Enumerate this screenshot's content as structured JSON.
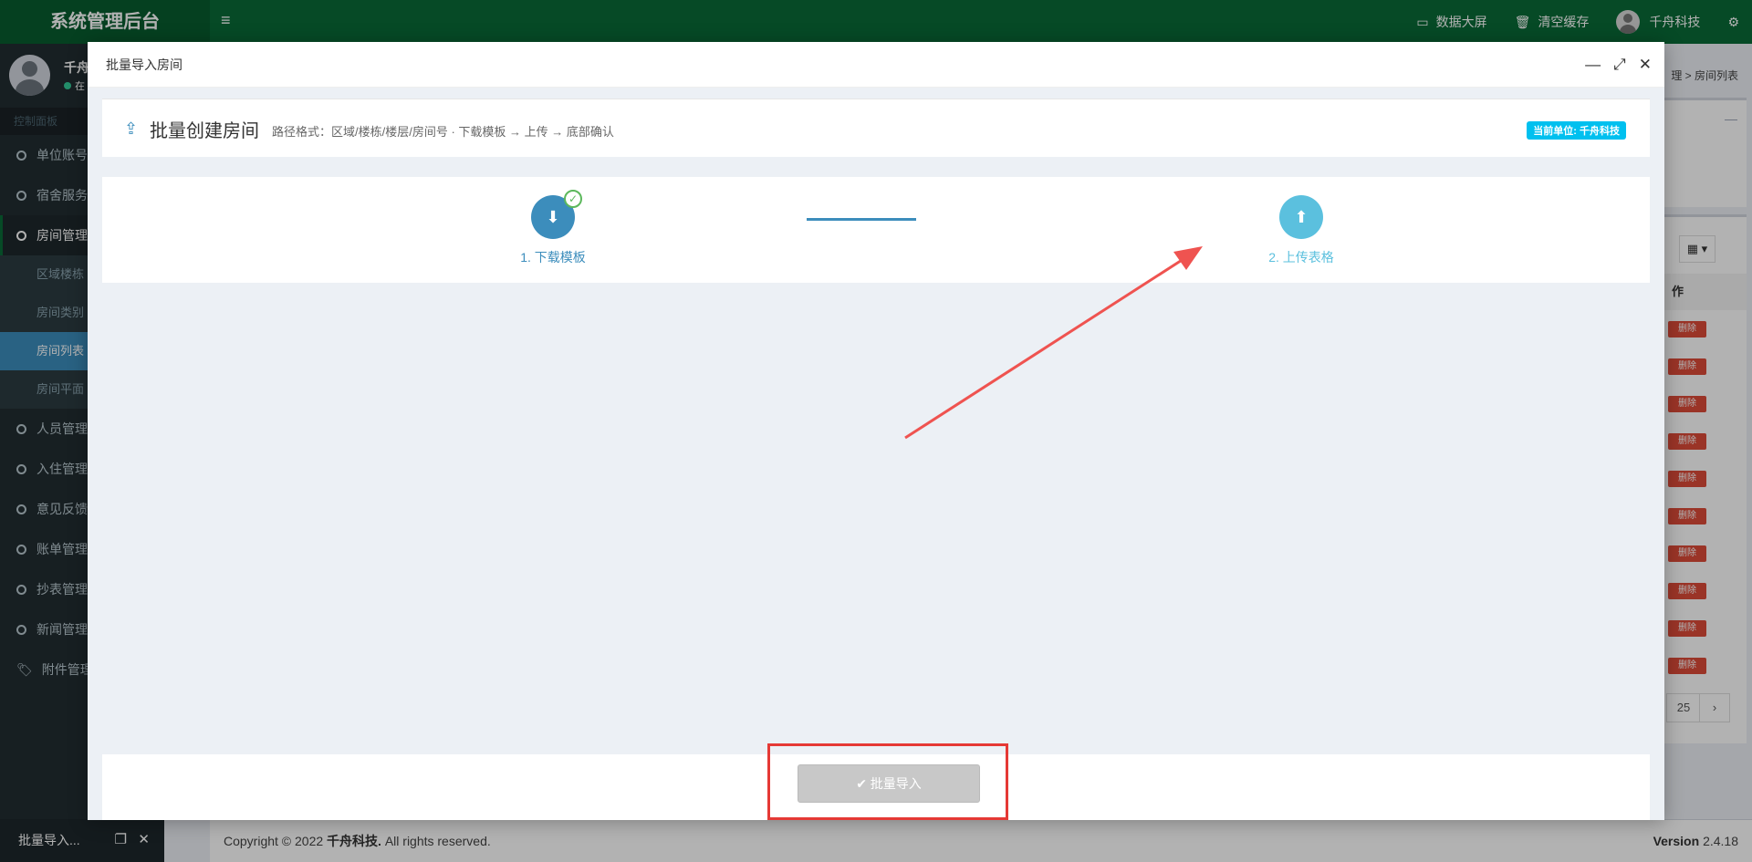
{
  "app": {
    "title": "系统管理后台",
    "menu_icon": "hamburger-icon",
    "top_items": [
      {
        "icon": "monitor-icon",
        "label": "数据大屏"
      },
      {
        "icon": "trash-icon",
        "label": "清空缓存"
      },
      {
        "icon": "avatar",
        "label": "千舟科技"
      }
    ],
    "settings_icon": "gears-icon"
  },
  "sidebar": {
    "user_name": "千舟",
    "user_status": "在",
    "header": "控制面板",
    "items": [
      {
        "label": "单位账号",
        "active": false
      },
      {
        "label": "宿舍服务",
        "active": false
      },
      {
        "label": "房间管理",
        "active": true
      }
    ],
    "sub_items": [
      {
        "label": "区域楼栋",
        "active": false
      },
      {
        "label": "房间类别",
        "active": false
      },
      {
        "label": "房间列表",
        "active": true
      },
      {
        "label": "房间平面",
        "active": false
      }
    ],
    "items_after": [
      {
        "label": "人员管理"
      },
      {
        "label": "入住管理"
      },
      {
        "label": "意见反馈"
      },
      {
        "label": "账单管理"
      },
      {
        "label": "抄表管理"
      },
      {
        "label": "新闻管理"
      },
      {
        "label": "附件管理"
      }
    ]
  },
  "background": {
    "breadcrumb": "理 > 房间列表",
    "table_header": "作",
    "delete_label": "删除",
    "delete_count": 10,
    "pager": [
      "25",
      "›"
    ]
  },
  "modal": {
    "title": "批量导入房间",
    "heading": "批量创建房间",
    "subtitle": "路径格式：区域/楼栋/楼层/房间号 · 下载模板 → 上传 → 底部确认",
    "badge": "当前单位: 千舟科技",
    "steps": [
      {
        "label": "1. 下载模板",
        "icon": "download-icon",
        "done": true
      },
      {
        "label": "2. 上传表格",
        "icon": "upload-icon",
        "done": false
      }
    ],
    "import_button": "✔ 批量导入"
  },
  "footer": {
    "copyright_prefix": "Copyright © 2022 ",
    "company": "千舟科技.",
    "rights": " All rights reserved.",
    "version_label": "Version",
    "version": "2.4.18"
  },
  "minimized_layer": {
    "label": "批量导入..."
  }
}
